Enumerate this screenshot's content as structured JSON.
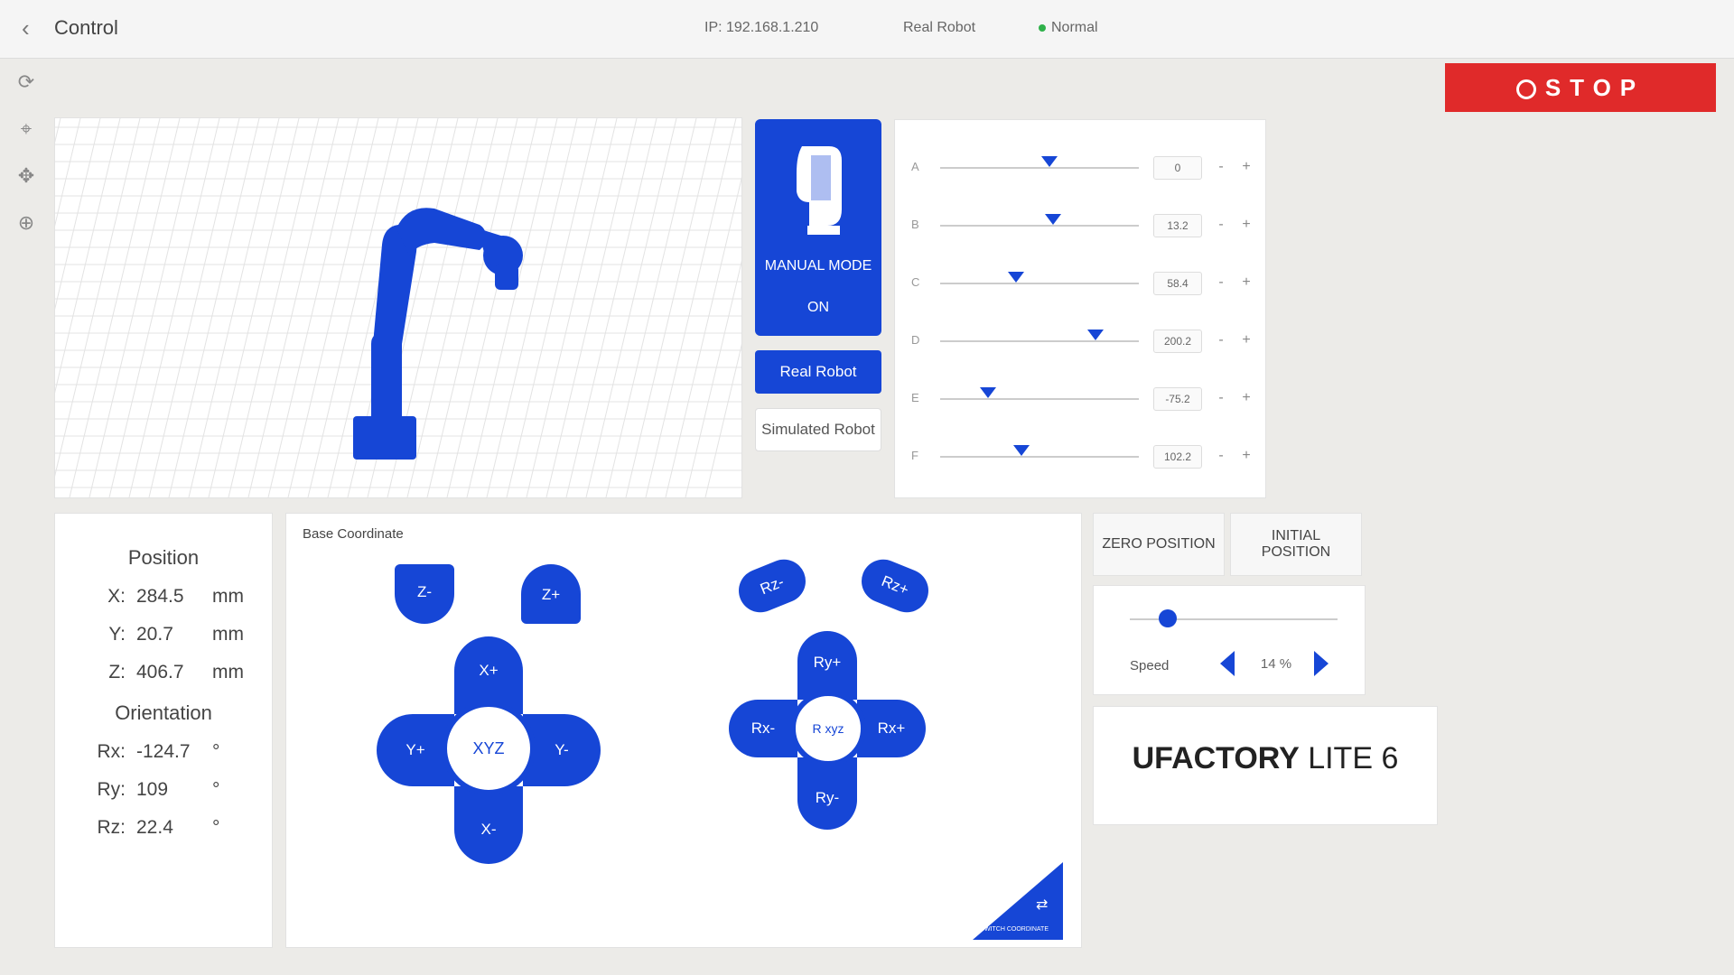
{
  "header": {
    "back_icon": "chevron-left-icon",
    "title": "Control",
    "ip": "IP: 192.168.1.210",
    "mode_label": "Real Robot",
    "status": "Normal",
    "status_color": "#2fb14a",
    "stop_label": "STOP"
  },
  "toolbar": {
    "icons": [
      "rotate-icon",
      "location-pin-icon",
      "move-arrows-icon",
      "target-icon"
    ]
  },
  "mode": {
    "title": "MANUAL MODE",
    "state": "ON",
    "real_label": "Real Robot",
    "sim_label": "Simulated Robot"
  },
  "joints": [
    {
      "label": "A",
      "value": "0",
      "level": 0.55
    },
    {
      "label": "B",
      "value": "13.2",
      "level": 0.57
    },
    {
      "label": "C",
      "value": "58.4",
      "level": 0.38
    },
    {
      "label": "D",
      "value": "200.2",
      "level": 0.78
    },
    {
      "label": "E",
      "value": "-75.2",
      "level": 0.24
    },
    {
      "label": "F",
      "value": "102.2",
      "level": 0.41
    }
  ],
  "position": {
    "title": "Position",
    "x": {
      "label": "X:",
      "value": "284.5",
      "unit": "mm"
    },
    "y": {
      "label": "Y:",
      "value": "20.7",
      "unit": "mm"
    },
    "z": {
      "label": "Z:",
      "value": "406.7",
      "unit": "mm"
    },
    "orientation_title": "Orientation",
    "rx": {
      "label": "Rx:",
      "value": "-124.7",
      "unit": "°"
    },
    "ry": {
      "label": "Ry:",
      "value": "109",
      "unit": "°"
    },
    "rz": {
      "label": "Rz:",
      "value": "22.4",
      "unit": "°"
    }
  },
  "jog": {
    "caption": "Base Coordinate",
    "z_minus": "Z-",
    "z_plus": "Z+",
    "x_plus": "X+",
    "x_minus": "X-",
    "y_plus": "Y+",
    "y_minus": "Y-",
    "xyz": "XYZ",
    "rz_minus": "Rz-",
    "rz_plus": "Rz+",
    "ry_plus": "Ry+",
    "ry_minus": "Ry-",
    "rx_minus": "Rx-",
    "rx_plus": "Rx+",
    "rxyz": "R xyz",
    "switch_label": "SWITCH COORDINATE"
  },
  "controls": {
    "zero_label": "ZERO POSITION",
    "initial_label": "INITIAL POSITION",
    "speed_label": "Speed",
    "speed_value": "14 %",
    "speed_level": 0.14
  },
  "brand": {
    "bold": "UFACTORY",
    "model": " LITE 6"
  },
  "colors": {
    "accent": "#1646d6",
    "stop": "#e02a2a"
  }
}
